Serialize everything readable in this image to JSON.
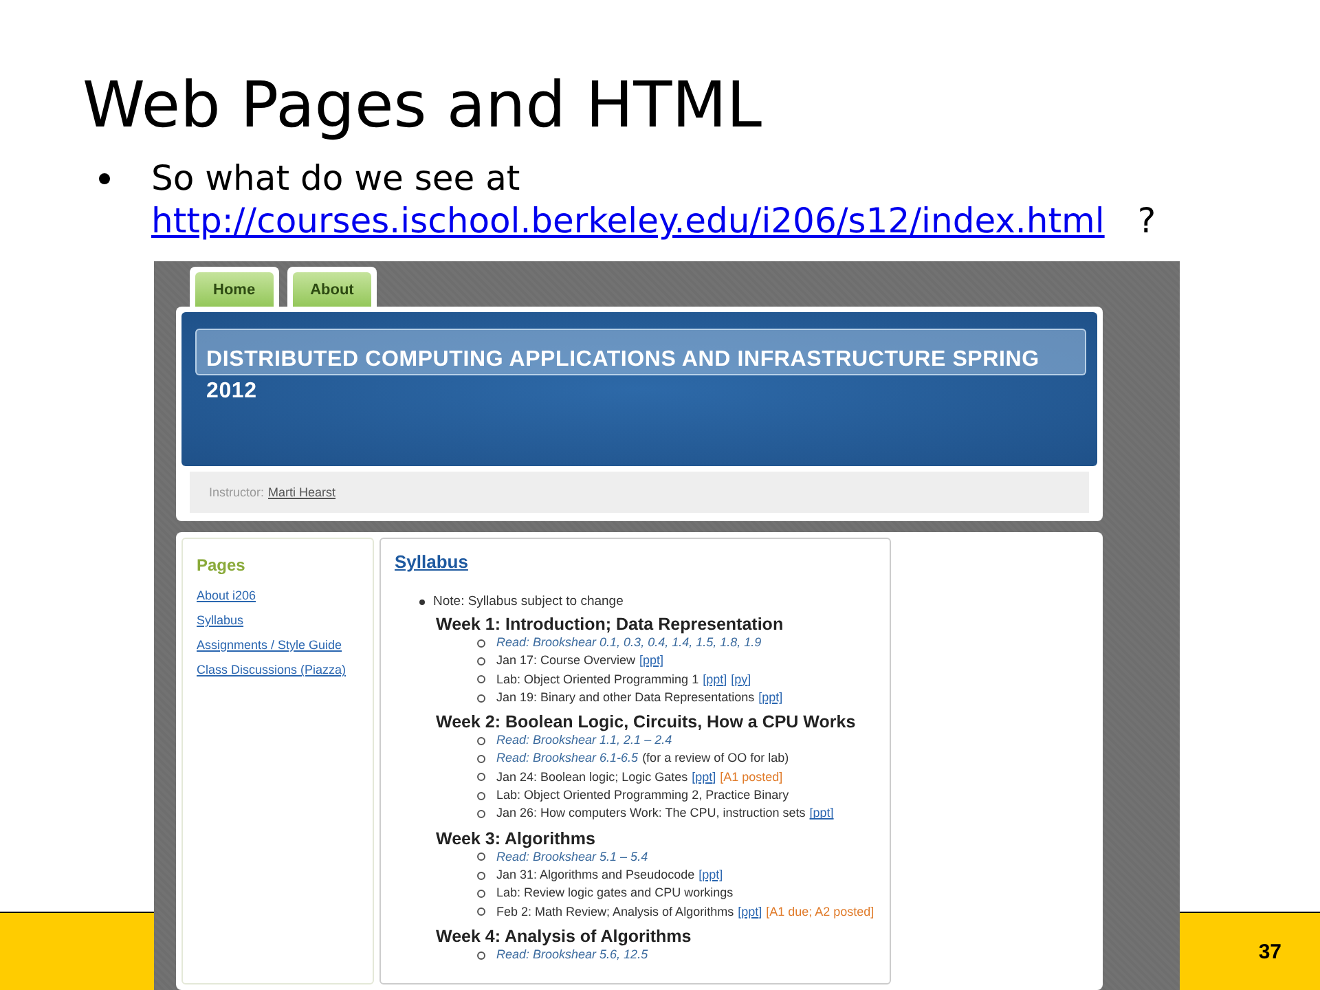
{
  "slide": {
    "title": "Web Pages and HTML",
    "bullet": {
      "text": "So what do we see at",
      "link": "http://courses.ischool.berkeley.edu/i206/s12/index.html",
      "suffix": "?"
    },
    "page_number": "37"
  },
  "screenshot": {
    "tabs": [
      {
        "label": "Home"
      },
      {
        "label": "About"
      }
    ],
    "banner": {
      "title": "DISTRIBUTED COMPUTING APPLICATIONS AND INFRASTRUCTURE SPRING 2012"
    },
    "instructor": {
      "label": "Instructor:",
      "name": "Marti Hearst"
    },
    "sidebar": {
      "heading": "Pages",
      "items": [
        "About i206",
        "Syllabus",
        "Assignments / Style Guide",
        "Class Discussions (Piazza)"
      ]
    },
    "main": {
      "heading": "Syllabus",
      "note": "Note: Syllabus subject to change",
      "weeks": [
        {
          "title": "Week 1: Introduction; Data Representation",
          "items": [
            [
              {
                "kind": "read",
                "text": "Read: Brookshear 0.1, 0.3, 0.4, 1.4, 1.5, 1.8, 1.9"
              }
            ],
            [
              {
                "kind": "text",
                "text": "Jan 17: Course Overview "
              },
              {
                "kind": "link",
                "text": "[ppt]"
              }
            ],
            [
              {
                "kind": "text",
                "text": "Lab: Object Oriented Programming 1"
              },
              {
                "kind": "link",
                "text": "[ppt]"
              },
              {
                "kind": "link",
                "text": "[py]"
              }
            ],
            [
              {
                "kind": "text",
                "text": "Jan 19: Binary and other Data Representations"
              },
              {
                "kind": "link",
                "text": "[ppt]"
              }
            ]
          ]
        },
        {
          "title": "Week 2: Boolean Logic, Circuits, How a CPU Works",
          "items": [
            [
              {
                "kind": "read",
                "text": "Read: Brookshear 1.1, 2.1 – 2.4"
              }
            ],
            [
              {
                "kind": "read",
                "text": "Read: Brookshear 6.1-6.5"
              },
              {
                "kind": "text",
                "text": "(for a review of OO for lab)"
              }
            ],
            [
              {
                "kind": "text",
                "text": "Jan 24: Boolean logic; Logic Gates"
              },
              {
                "kind": "link",
                "text": "[ppt]"
              },
              {
                "kind": "note",
                "text": "[A1 posted]"
              }
            ],
            [
              {
                "kind": "text",
                "text": "Lab: Object Oriented Programming 2, Practice Binary"
              }
            ],
            [
              {
                "kind": "text",
                "text": "Jan 26: How computers Work: The CPU, instruction sets"
              },
              {
                "kind": "link",
                "text": "[ppt]"
              }
            ]
          ]
        },
        {
          "title": "Week 3: Algorithms",
          "items": [
            [
              {
                "kind": "read",
                "text": "Read: Brookshear 5.1 – 5.4"
              }
            ],
            [
              {
                "kind": "text",
                "text": "Jan 31: Algorithms and Pseudocode"
              },
              {
                "kind": "link",
                "text": "[ppt]"
              }
            ],
            [
              {
                "kind": "text",
                "text": "Lab: Review logic gates and CPU workings"
              }
            ],
            [
              {
                "kind": "text",
                "text": "Feb 2: Math Review; Analysis of Algorithms"
              },
              {
                "kind": "link",
                "text": "[ppt]"
              },
              {
                "kind": "note",
                "text": "[A1 due; A2 posted]"
              }
            ]
          ]
        },
        {
          "title": "Week 4: Analysis of Algorithms",
          "items": [
            [
              {
                "kind": "read",
                "text": "Read: Brookshear 5.6, 12.5"
              }
            ]
          ]
        }
      ]
    }
  }
}
